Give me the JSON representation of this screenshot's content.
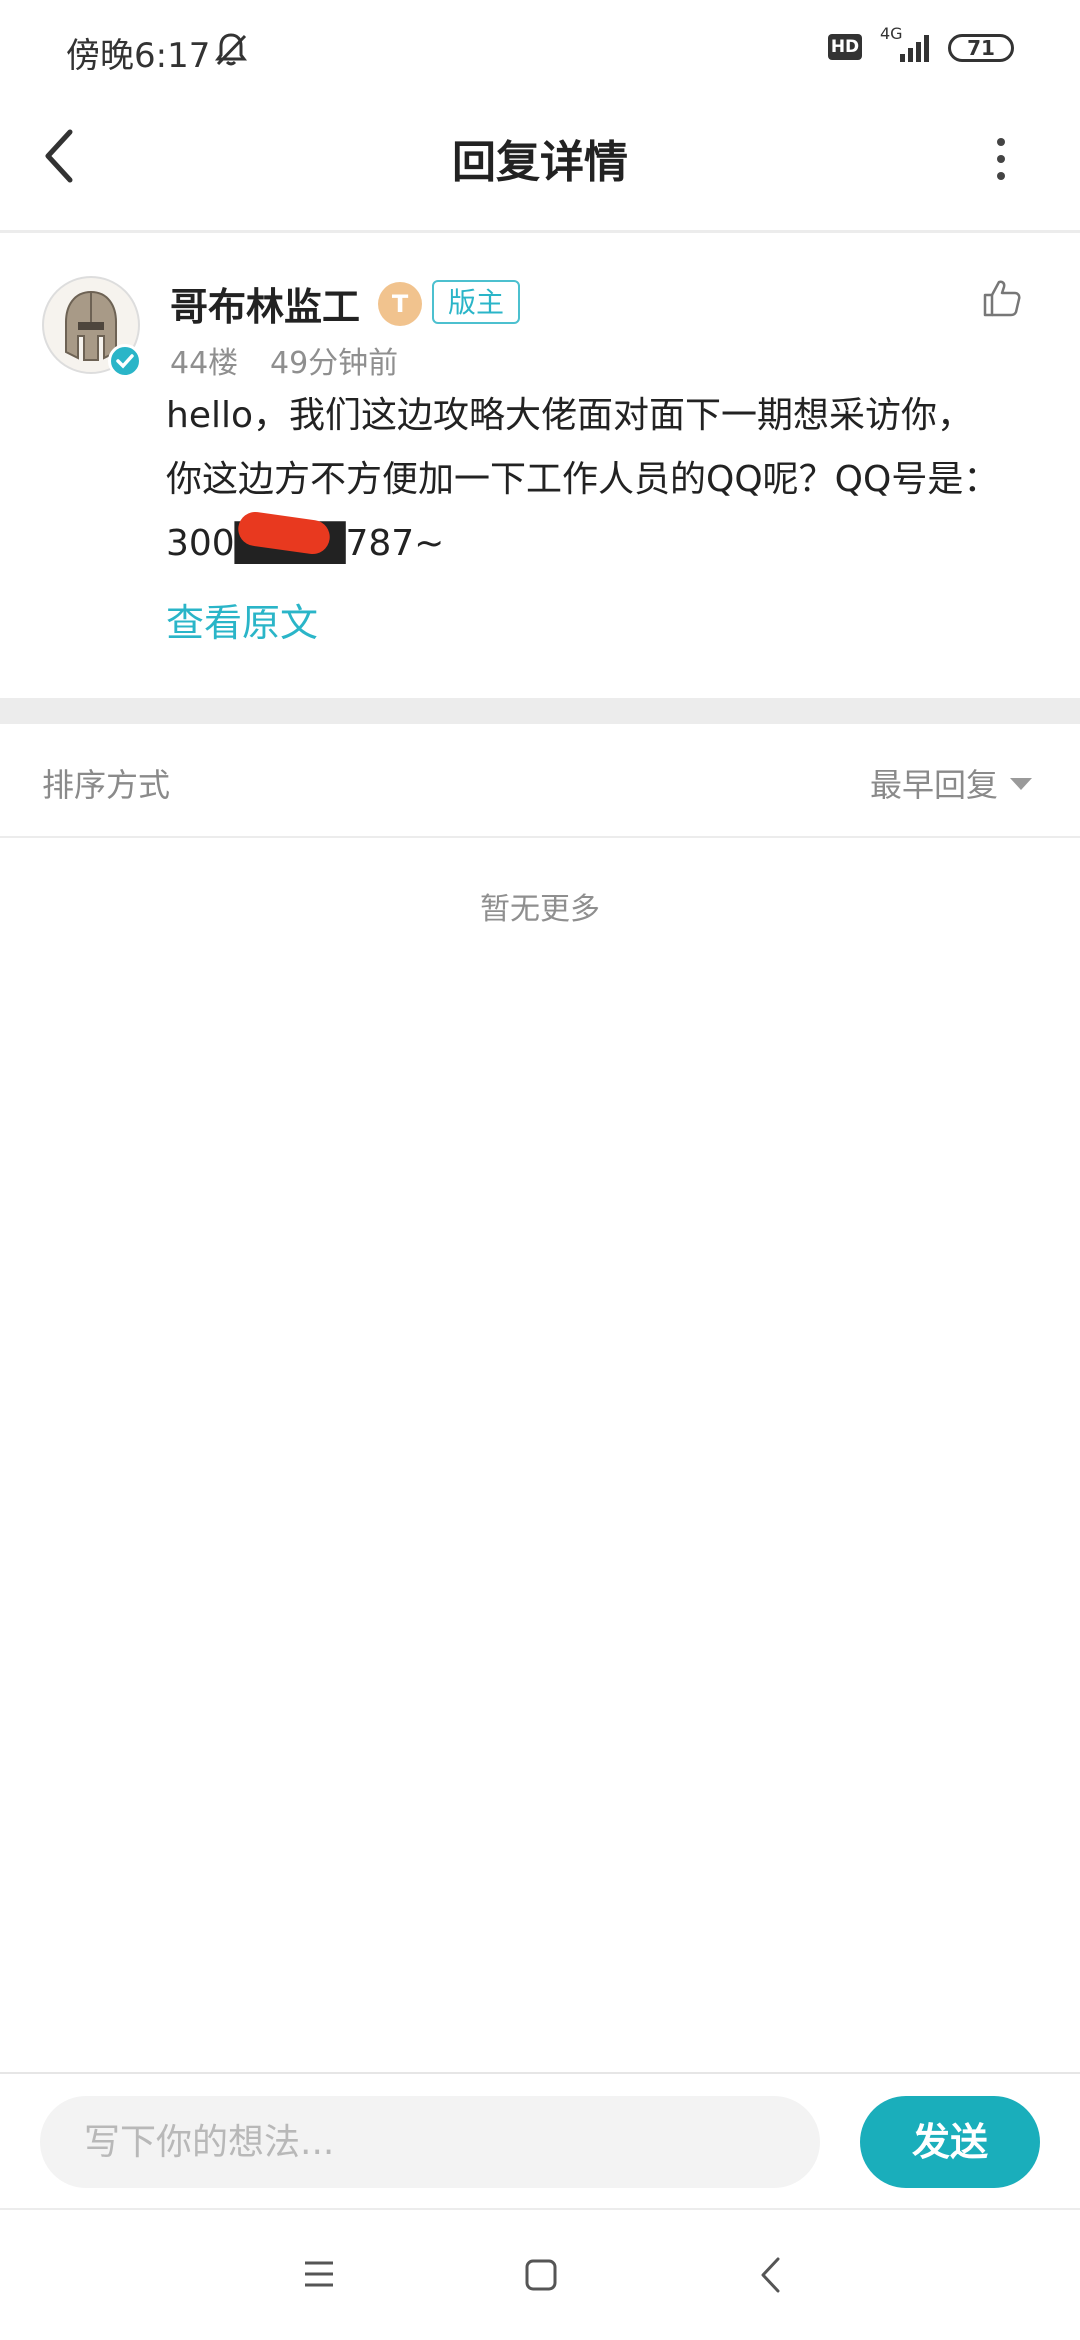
{
  "status_bar": {
    "time": "傍晚6:17",
    "hd": "HD",
    "network": "4G",
    "battery": "71"
  },
  "header": {
    "title": "回复详情"
  },
  "post": {
    "username": "哥布林监工",
    "level_badge": "T",
    "role_badge": "版主",
    "floor": "44楼",
    "time_ago": "49分钟前",
    "content_line1": "hello，我们这边攻略大佬面对面下一期想采访你，",
    "content_line2": "你这边方不方便加一下工作人员的QQ呢？QQ号是：",
    "content_line3": "300████787~",
    "view_original": "查看原文"
  },
  "sort": {
    "label": "排序方式",
    "value": "最早回复"
  },
  "empty_text": "暂无更多",
  "composer": {
    "placeholder": "写下你的想法...",
    "send_label": "发送"
  },
  "colors": {
    "accent": "#2ab5c8",
    "send_button": "#1aaebb",
    "divider": "#ececec",
    "muted_text": "#8f8f8f"
  },
  "icons": {
    "status": [
      "bell-muted-icon",
      "signal-icon",
      "battery-icon"
    ],
    "header": [
      "back-arrow-icon",
      "more-vertical-icon"
    ],
    "post": [
      "avatar-helmet-icon",
      "verified-icon",
      "thumbs-up-icon"
    ],
    "nav": [
      "menu-icon",
      "home-square-icon",
      "back-icon"
    ]
  }
}
